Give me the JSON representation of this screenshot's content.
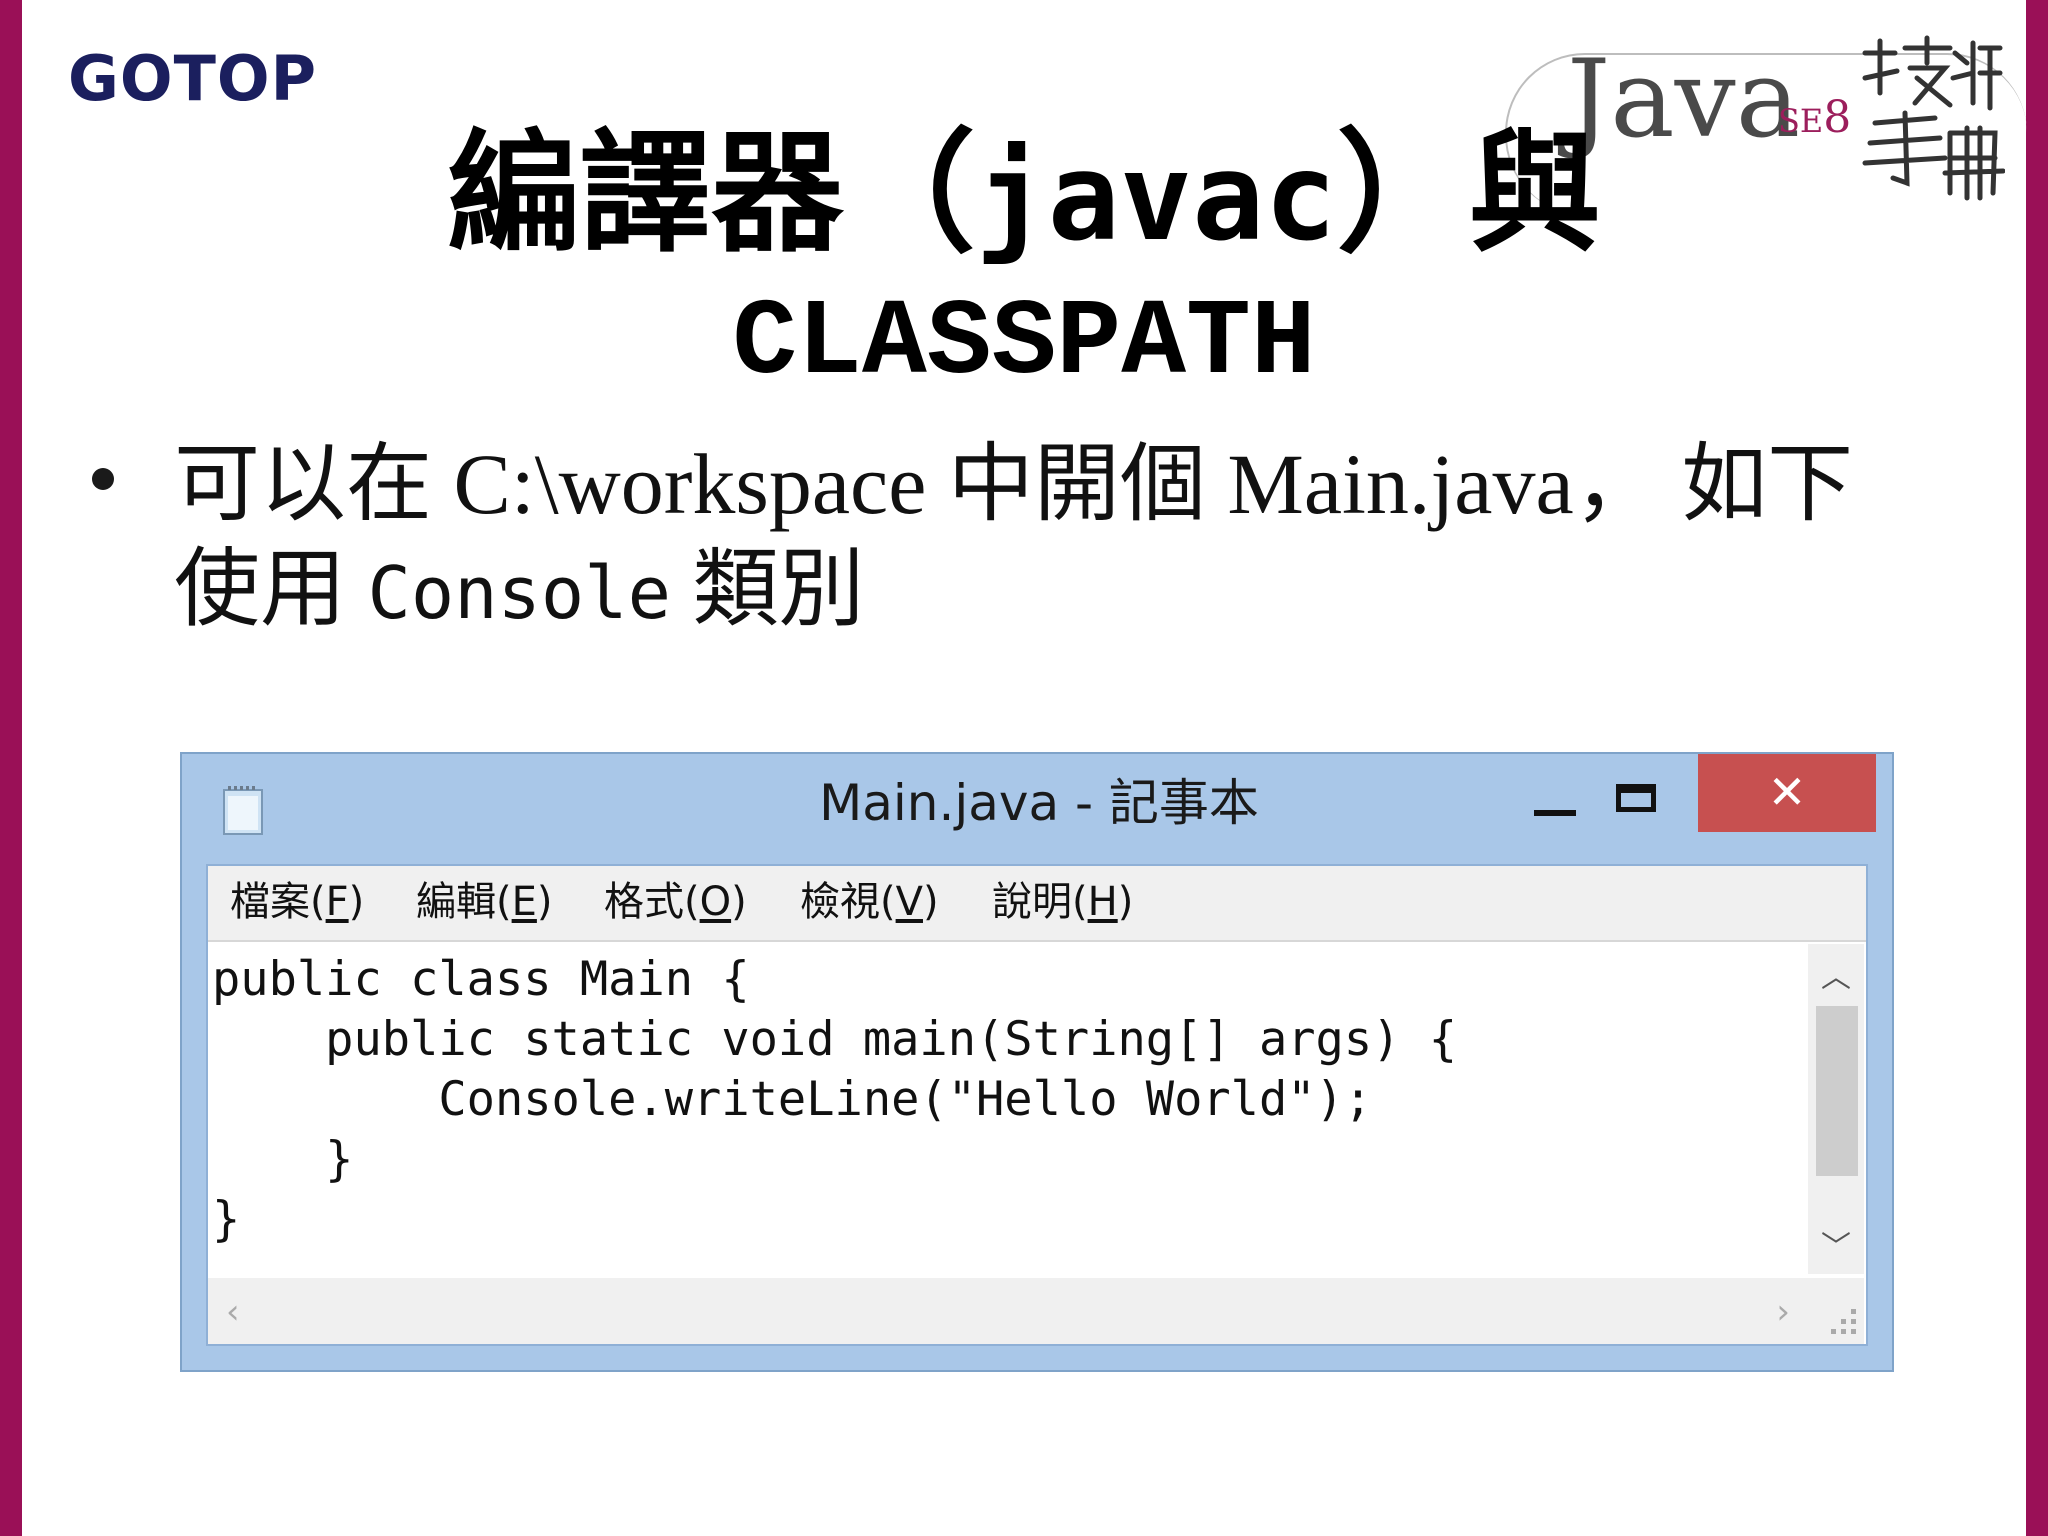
{
  "colors": {
    "frame": "#9a1057",
    "logo": "#1b1f5e",
    "close_button": "#c75050",
    "window_chrome": "#a9c7e8"
  },
  "logo": {
    "text": "GOTOP"
  },
  "brand": {
    "java": "Java",
    "se": "SE",
    "version": "8",
    "calligraphy": "技術手冊"
  },
  "slide": {
    "title_part1": "編譯器（",
    "title_code": "javac",
    "title_part2": "）與",
    "title_line2": "CLASSPATH",
    "bullet_line1": "可以在 C:\\workspace 中開個 Main.java， 如下",
    "bullet_line2_prefix": "使用",
    "bullet_line2_code": "Console",
    "bullet_line2_suffix": "類別"
  },
  "notepad": {
    "title": "Main.java - 記事本",
    "close_glyph": "✕",
    "menu": [
      {
        "label": "檔案(",
        "key": "F",
        "end": ")"
      },
      {
        "label": "編輯(",
        "key": "E",
        "end": ")"
      },
      {
        "label": "格式(",
        "key": "O",
        "end": ")"
      },
      {
        "label": "檢視(",
        "key": "V",
        "end": ")"
      },
      {
        "label": "說明(",
        "key": "H",
        "end": ")"
      }
    ],
    "code_lines": [
      "public class Main {",
      "    public static void main(String[] args) {",
      "        Console.writeLine(\"Hello World\");",
      "    }",
      "}"
    ]
  }
}
